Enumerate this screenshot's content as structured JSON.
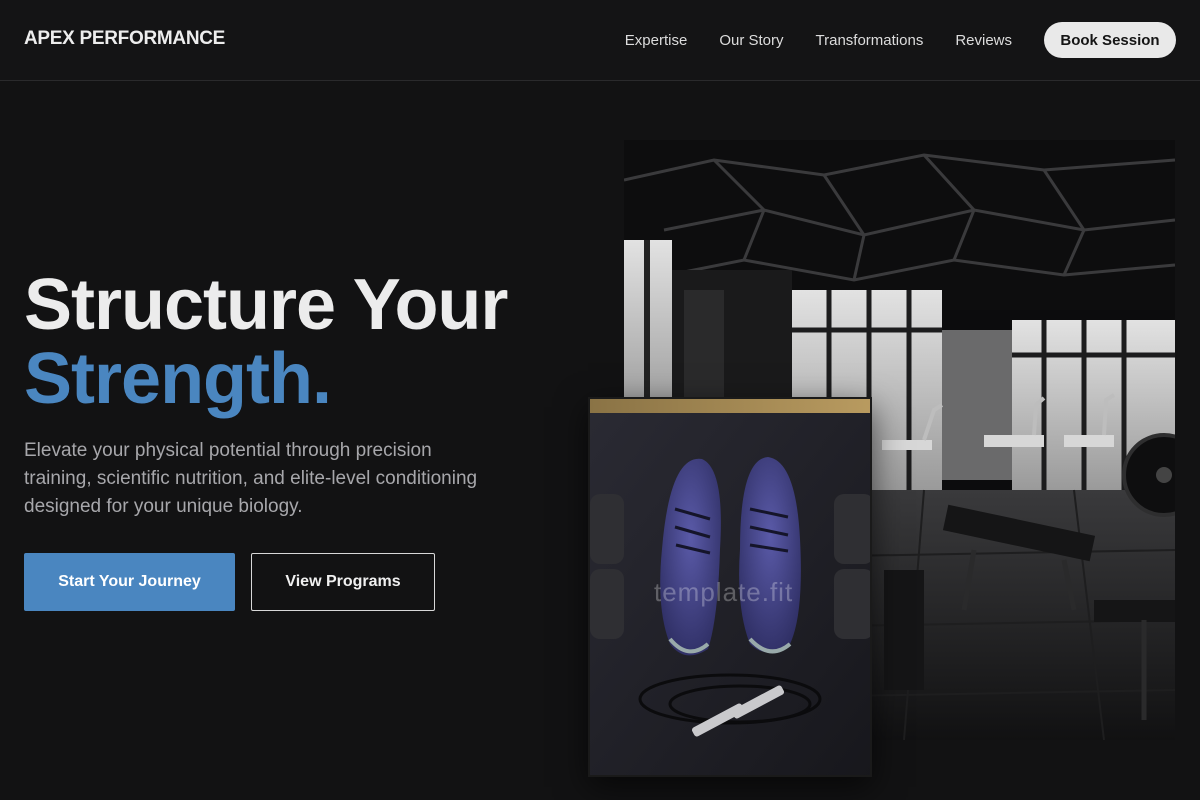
{
  "brand": {
    "name": "APEX PERFORMANCE"
  },
  "nav": {
    "items": [
      "Expertise",
      "Our Story",
      "Transformations",
      "Reviews"
    ],
    "cta": "Book Session"
  },
  "hero": {
    "headline_line1": "Structure Your",
    "headline_line2": "Strength.",
    "description": "Elevate your physical potential through precision training, scientific nutrition, and elite-level conditioning designed for your unique biology.",
    "primary_button": "Start Your Journey",
    "secondary_button": "View Programs"
  },
  "images": {
    "gym_alt": "Black and white gym interior with treadmills and benches",
    "shoes_alt": "Blue running shoes with dumbbells and jump rope",
    "watermark": "template.fit"
  },
  "colors": {
    "background": "#121213",
    "accent": "#4a86c0",
    "text": "#ececec",
    "muted": "#a7a7ab"
  }
}
